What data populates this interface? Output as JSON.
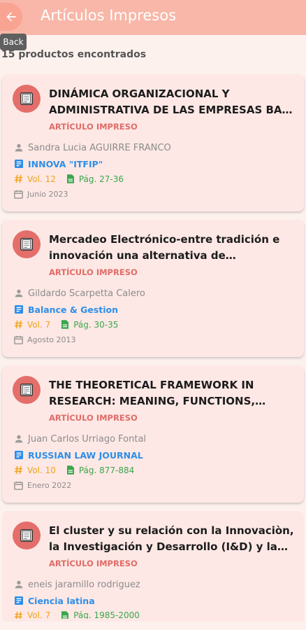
{
  "header": {
    "title": "Artículos Impresos",
    "back_tooltip": "Back"
  },
  "results_count": "15 productos encontrados",
  "items": [
    {
      "title": "DINÁMICA ORGANIZACIONAL Y ADMINISTRATIVA DE LAS EMPRESAS BAJO LA INFLUENCIA DEL CONTEXTO",
      "type": "ARTÍCULO IMPRESO",
      "author": "Sandra Lucia AGUIRRE FRANCO",
      "journal": "INNOVA \"ITFIP\"",
      "volume": "Vol. 12",
      "pages": "Pág. 27-36",
      "date": "Junio 2023"
    },
    {
      "title": "Mercadeo Electrónico-entre tradición e innovación una alternativa de emprendimiento empresarial",
      "type": "ARTÍCULO IMPRESO",
      "author": "Gildardo Scarpetta Calero",
      "journal": "Balance & Gestion",
      "volume": "Vol. 7",
      "pages": "Pág. 30-35",
      "date": "Agosto 2013"
    },
    {
      "title": "THE THEORETICAL FRAMEWORK IN RESEARCH: MEANING, FUNCTIONS, STRUCTURE AND FORMS",
      "type": "ARTÍCULO IMPRESO",
      "author": "Juan Carlos Urriago Fontal",
      "journal": "RUSSIAN LAW JOURNAL",
      "volume": "Vol. 10",
      "pages": "Pág. 877-884",
      "date": "Enero 2022"
    },
    {
      "title": "El cluster y su relación con la Innovaciòn, la Investigación y Desarrollo (I&D) y la transferencia de tecnología",
      "type": "ARTÍCULO IMPRESO",
      "author": "eneis jaramillo rodriguez",
      "journal": "Ciencia latina",
      "volume": "Vol. 7",
      "pages": "Pág. 1985-2000",
      "date": ""
    }
  ],
  "icons": {
    "back": "arrow-left-icon",
    "avatar": "document-icon",
    "author": "person-icon",
    "journal": "article-icon",
    "volume": "hash-icon",
    "pages": "file-icon",
    "date": "calendar-icon"
  },
  "colors": {
    "appbar": "#f8b7a8",
    "accent": "#e06b67",
    "journal": "#2d8ee8",
    "volume": "#f2a21a",
    "pages": "#3aa64a"
  }
}
